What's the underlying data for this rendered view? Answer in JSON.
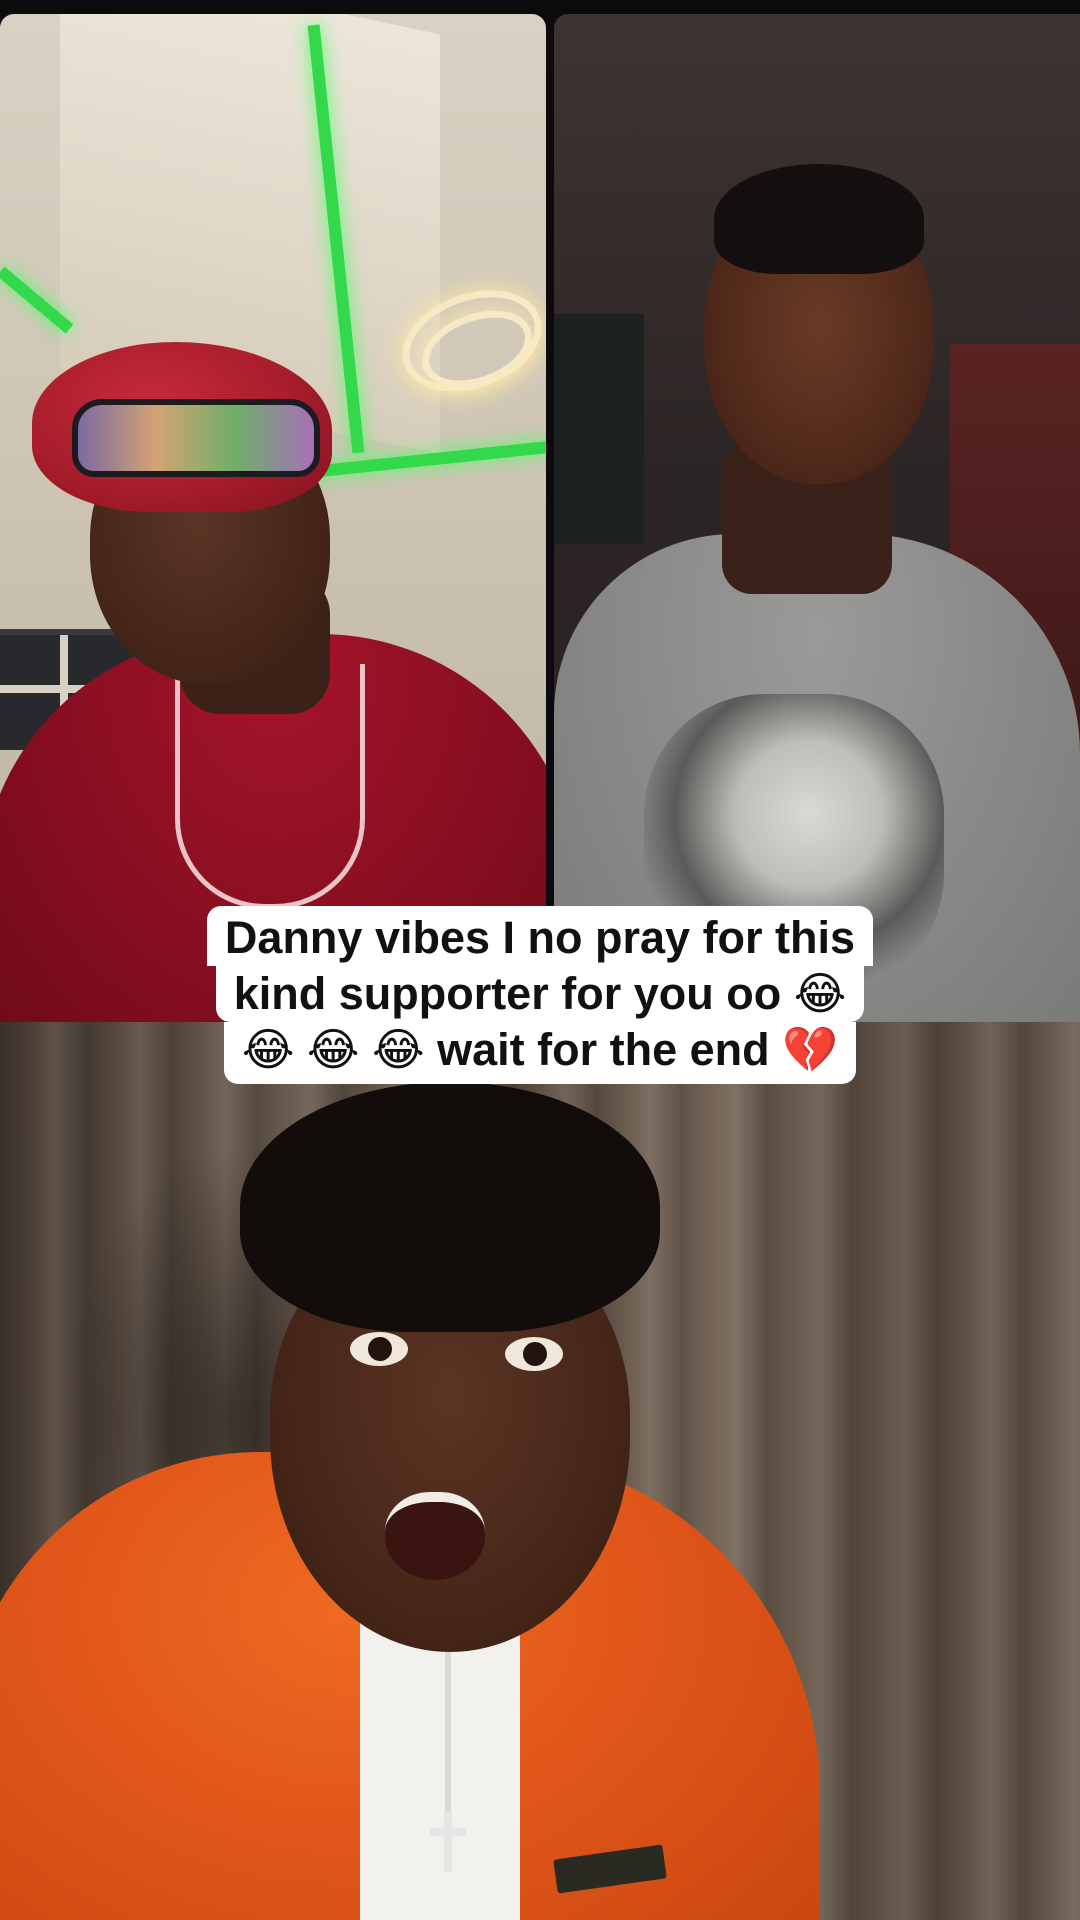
{
  "caption": {
    "lines": [
      "Danny vibes  I no pray for this",
      "kind supporter for you oo 😂",
      "😂 😂 😂 wait for the end 💔"
    ]
  },
  "colors": {
    "caption_bg": "#ffffff",
    "caption_text": "#111111",
    "beret_red": "#a81d2c",
    "ceiling_light_green": "#33d94a",
    "sweater_grey": "#8a8a88",
    "jacket_orange": "#e0561a"
  }
}
